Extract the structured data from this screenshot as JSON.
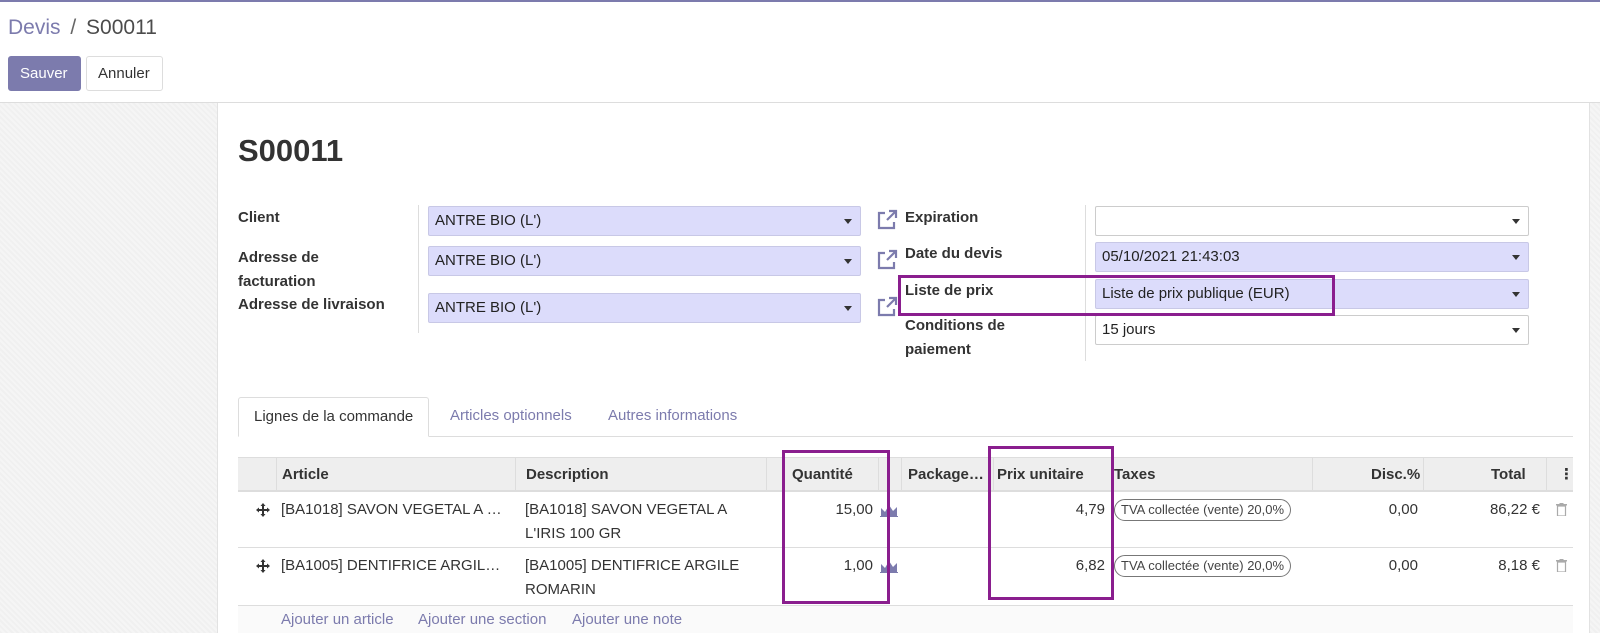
{
  "breadcrumb": {
    "parent": "Devis",
    "separator": "/",
    "current": "S00011"
  },
  "buttons": {
    "save": "Sauver",
    "cancel": "Annuler"
  },
  "record": {
    "title": "S00011"
  },
  "form": {
    "left": {
      "client_label": "Client",
      "client_value": "ANTRE BIO (L')",
      "invoice_label_1": "Adresse de",
      "invoice_label_2": "facturation",
      "invoice_value": "ANTRE BIO (L')",
      "delivery_label": "Adresse de livraison",
      "delivery_value": "ANTRE BIO (L')"
    },
    "right": {
      "expiration_label": "Expiration",
      "expiration_value": "",
      "date_label": "Date du devis",
      "date_value": "05/10/2021 21:43:03",
      "pricelist_label": "Liste de prix",
      "pricelist_value": "Liste de prix publique (EUR)",
      "terms_label_1": "Conditions de",
      "terms_label_2": "paiement",
      "terms_value": "15 jours"
    }
  },
  "tabs": [
    {
      "label": "Lignes de la commande",
      "active": true
    },
    {
      "label": "Articles optionnels",
      "active": false
    },
    {
      "label": "Autres informations",
      "active": false
    }
  ],
  "table": {
    "headers": {
      "article": "Article",
      "description": "Description",
      "quantity": "Quantité",
      "package": "Package…",
      "unit_price": "Prix unitaire",
      "taxes": "Taxes",
      "discount": "Disc.%",
      "total": "Total",
      "options": "⋮"
    },
    "rows": [
      {
        "article": "[BA1018] SAVON VEGETAL A …",
        "description_1": "[BA1018] SAVON VEGETAL A",
        "description_2": "L'IRIS 100 GR",
        "quantity": "15,00",
        "unit_price": "4,79",
        "tax": "TVA collectée (vente) 20,0%",
        "discount": "0,00",
        "total": "86,22 €"
      },
      {
        "article": "[BA1005] DENTIFRICE ARGIL…",
        "description_1": "[BA1005] DENTIFRICE ARGILE",
        "description_2": "ROMARIN",
        "quantity": "1,00",
        "unit_price": "6,82",
        "tax": "TVA collectée (vente) 20,0%",
        "discount": "0,00",
        "total": "8,18 €"
      }
    ],
    "add_links": {
      "article": "Ajouter un article",
      "section": "Ajouter une section",
      "note": "Ajouter une note"
    }
  },
  "colors": {
    "brand": "#7c7bad",
    "field_bg": "#dcdcfb",
    "highlight": "#8a1e8e"
  }
}
